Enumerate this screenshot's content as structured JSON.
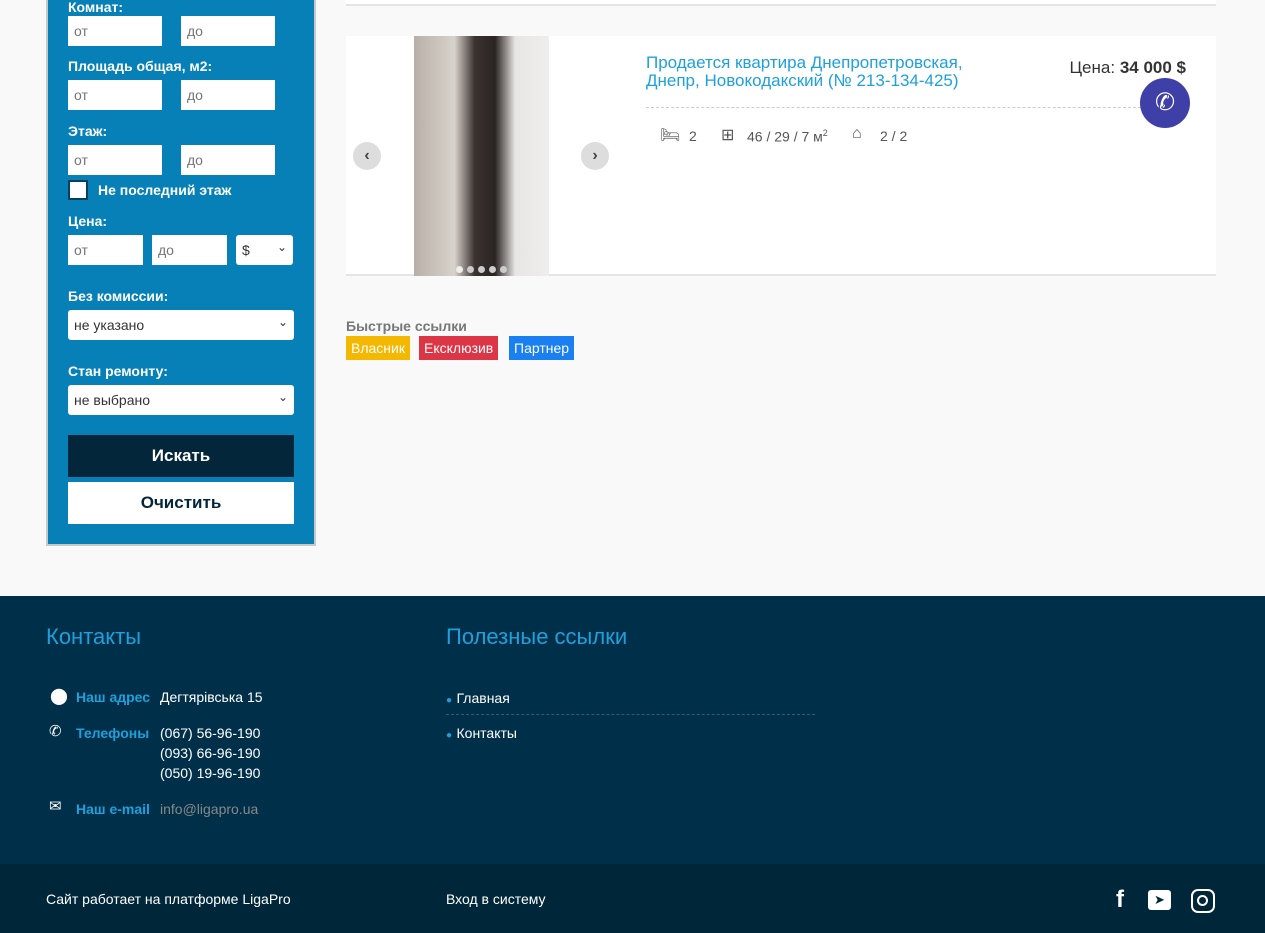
{
  "filter": {
    "rooms_label": "Комнат:",
    "area_label": "Площадь общая, м2:",
    "floor_label": "Этаж:",
    "from_placeholder": "от",
    "to_placeholder": "до",
    "not_last_floor": "Не последний этаж",
    "price_label": "Цена:",
    "currency": "$",
    "commission_label": "Без комиссии:",
    "commission_value": "не указано",
    "repair_label": "Стан ремонту:",
    "repair_value": "не выбрано",
    "search_button": "Искать",
    "clear_button": "Очистить"
  },
  "listing": {
    "title": "Продается квартира Днепропетровская, Днепр, Новокодакский  (№ 213-134-425)",
    "price_label": "Цена:",
    "price_value": "34 000 $",
    "rooms": "2",
    "area": "46 / 29 / 7 м",
    "area_sup": "2",
    "floors": "2 / 2",
    "photo_count": 5
  },
  "quick_links": {
    "title": "Быстрые ссылки",
    "tags": [
      {
        "label": "Власник",
        "color": "#f5b800"
      },
      {
        "label": "Ексклюзив",
        "color": "#dc3545"
      },
      {
        "label": "Партнер",
        "color": "#1a7ff0"
      }
    ]
  },
  "footer": {
    "contacts_title": "Контакты",
    "links_title": "Полезные ссылки",
    "address_label": "Наш адрес",
    "address": "Дегтярівська 15",
    "phones_label": "Телефоны",
    "phones": [
      "(067) 56-96-190",
      "(093) 66-96-190",
      "(050) 19-96-190"
    ],
    "email_label": "Наш e-mail",
    "email": "info@ligapro.ua",
    "links": [
      "Главная",
      "Контакты"
    ],
    "platform": "Сайт работает на платформе LigaPro",
    "login": "Вход в систему"
  }
}
